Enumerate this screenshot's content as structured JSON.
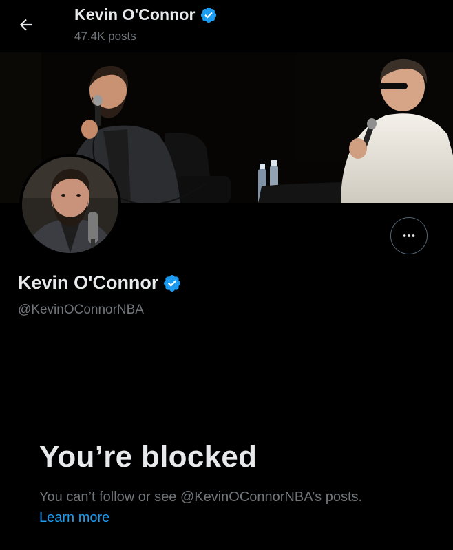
{
  "header": {
    "name": "Kevin O'Connor",
    "posts": "47.4K posts",
    "back_icon": "arrow-left-icon"
  },
  "profile": {
    "name": "Kevin O'Connor",
    "handle": "@KevinOConnorNBA",
    "verified": true
  },
  "blocked": {
    "title": "You’re blocked",
    "message": "You can’t follow or see @KevinOConnorNBA’s posts.",
    "link": "Learn more"
  },
  "colors": {
    "background": "#000000",
    "text_primary": "#e7e9ea",
    "text_secondary": "#71767b",
    "accent": "#1d9bf0",
    "border": "#2f3336"
  }
}
